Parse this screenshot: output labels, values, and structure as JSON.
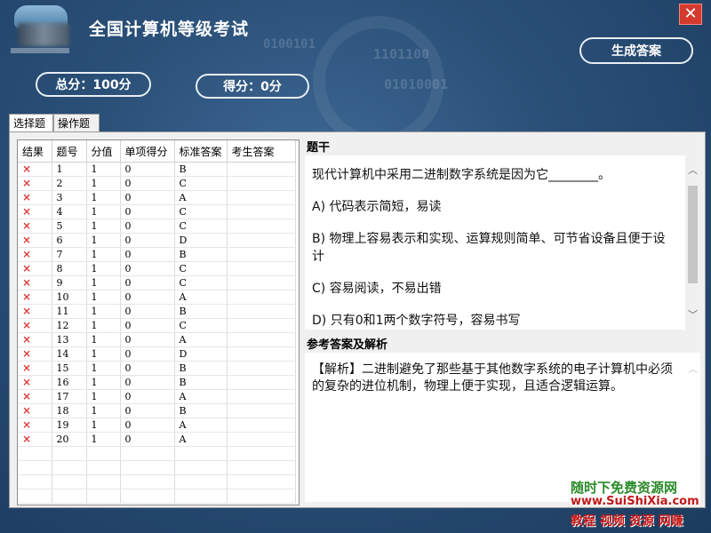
{
  "window": {
    "title": "全国计算机等级考试",
    "close_label": "✕"
  },
  "header": {
    "generate_button": "生成答案",
    "total_score": "总分：100分",
    "score": "得分：0分",
    "deco_lines": [
      "0100101",
      "1101100",
      "01010001"
    ]
  },
  "tabs": [
    {
      "label": "选择题",
      "active": true
    },
    {
      "label": "操作题",
      "active": false
    }
  ],
  "grid": {
    "columns": [
      "结果",
      "题号",
      "分值",
      "单项得分",
      "标准答案",
      "考生答案"
    ],
    "rows": [
      [
        "×",
        "1",
        "1",
        "0",
        "B",
        ""
      ],
      [
        "×",
        "2",
        "1",
        "0",
        "C",
        ""
      ],
      [
        "×",
        "3",
        "1",
        "0",
        "A",
        ""
      ],
      [
        "×",
        "4",
        "1",
        "0",
        "C",
        ""
      ],
      [
        "×",
        "5",
        "1",
        "0",
        "C",
        ""
      ],
      [
        "×",
        "6",
        "1",
        "0",
        "D",
        ""
      ],
      [
        "×",
        "7",
        "1",
        "0",
        "B",
        ""
      ],
      [
        "×",
        "8",
        "1",
        "0",
        "C",
        ""
      ],
      [
        "×",
        "9",
        "1",
        "0",
        "C",
        ""
      ],
      [
        "×",
        "10",
        "1",
        "0",
        "A",
        ""
      ],
      [
        "×",
        "11",
        "1",
        "0",
        "B",
        ""
      ],
      [
        "×",
        "12",
        "1",
        "0",
        "C",
        ""
      ],
      [
        "×",
        "13",
        "1",
        "0",
        "A",
        ""
      ],
      [
        "×",
        "14",
        "1",
        "0",
        "D",
        ""
      ],
      [
        "×",
        "15",
        "1",
        "0",
        "B",
        ""
      ],
      [
        "×",
        "16",
        "1",
        "0",
        "B",
        ""
      ],
      [
        "×",
        "17",
        "1",
        "0",
        "A",
        ""
      ],
      [
        "×",
        "18",
        "1",
        "0",
        "B",
        ""
      ],
      [
        "×",
        "19",
        "1",
        "0",
        "A",
        ""
      ],
      [
        "×",
        "20",
        "1",
        "0",
        "A",
        ""
      ]
    ]
  },
  "question": {
    "label": "题干",
    "lines": [
      "现代计算机中采用二进制数字系统是因为它________。",
      "A) 代码表示简短，易读",
      "B) 物理上容易表示和实现、运算规则简单、可节省设备且便于设计",
      "C) 容易阅读，不易出错",
      "D) 只有0和1两个数字符号，容易书写"
    ]
  },
  "answer": {
    "label": "参考答案及解析",
    "text": "【解析】二进制避免了那些基于其他数字系统的电子计算机中必须的复杂的进位机制，物理上便于实现，且适合逻辑运算。"
  },
  "watermark": {
    "line1": "随时下免费资源网",
    "line2": "www.SuiShiXia.com",
    "line3": "教程 视频 资源 网赚"
  }
}
